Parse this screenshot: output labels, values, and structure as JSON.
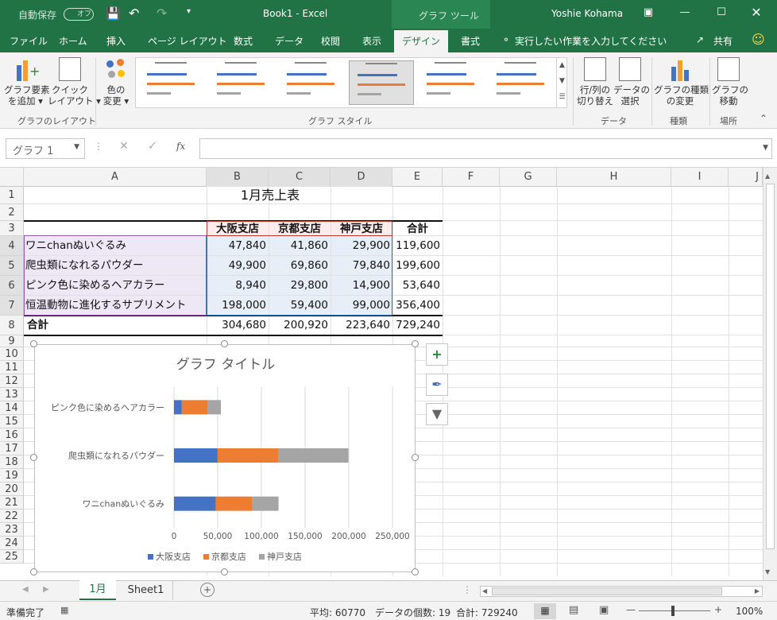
{
  "titlebar": {
    "autosave": "自動保存",
    "autosave_state": "オフ",
    "doc_title": "Book1 - Excel",
    "tools_context": "グラフ ツール",
    "user": "Yoshie Kohama"
  },
  "tabs": [
    "ファイル",
    "ホーム",
    "挿入",
    "ページ レイアウト",
    "数式",
    "データ",
    "校閲",
    "表示",
    "デザイン",
    "書式"
  ],
  "tell_me": "実行したい作業を入力してください",
  "share": "共有",
  "ribbon": {
    "add_element": [
      "グラフ要素",
      "を追加 ▾"
    ],
    "quick_layout": [
      "クイック",
      "レイアウト ▾"
    ],
    "change_colors": [
      "色の",
      "変更 ▾"
    ],
    "switch_rowcol": [
      "行/列の",
      "切り替え"
    ],
    "select_data": [
      "データの",
      "選択"
    ],
    "change_type": [
      "グラフの種類",
      "の変更"
    ],
    "move_chart": [
      "グラフの",
      "移動"
    ],
    "groups": {
      "layout": "グラフのレイアウト",
      "styles": "グラフ スタイル",
      "data": "データ",
      "type": "種類",
      "location": "場所"
    }
  },
  "formula": {
    "namebox": "グラフ 1",
    "fx": "fx"
  },
  "columns": [
    "A",
    "B",
    "C",
    "D",
    "E",
    "F",
    "G",
    "H",
    "I",
    "J"
  ],
  "rows": [
    "1",
    "2",
    "3",
    "4",
    "5",
    "6",
    "7",
    "8",
    "9",
    "10",
    "11",
    "12",
    "13",
    "14",
    "15",
    "16",
    "17",
    "18",
    "19",
    "20",
    "21",
    "22",
    "23",
    "24",
    "25"
  ],
  "sheet": {
    "title": "1月売上表",
    "headers": [
      "大阪支店",
      "京都支店",
      "神戸支店",
      "合計"
    ],
    "data": [
      {
        "name": "ワニchanぬいぐるみ",
        "vals": [
          "47,840",
          "41,860",
          "29,900",
          "119,600"
        ]
      },
      {
        "name": "爬虫類になれるパウダー",
        "vals": [
          "49,900",
          "69,860",
          "79,840",
          "199,600"
        ]
      },
      {
        "name": "ピンク色に染めるヘアカラー",
        "vals": [
          "8,940",
          "29,800",
          "14,900",
          "53,640"
        ]
      },
      {
        "name": "恒温動物に進化するサプリメント",
        "vals": [
          "198,000",
          "59,400",
          "99,000",
          "356,400"
        ]
      }
    ],
    "total": {
      "name": "合計",
      "vals": [
        "304,680",
        "200,920",
        "223,640",
        "729,240"
      ]
    }
  },
  "chart_data": {
    "type": "bar",
    "title": "グラフ タイトル",
    "categories": [
      "ワニchanぬいぐるみ",
      "爬虫類になれるパウダー",
      "ピンク色に染めるヘアカラー"
    ],
    "series": [
      {
        "name": "大阪支店",
        "values": [
          47840,
          49900,
          8940
        ],
        "color": "#4472c4"
      },
      {
        "name": "京都支店",
        "values": [
          41860,
          69860,
          29800
        ],
        "color": "#ed7d31"
      },
      {
        "name": "神戸支店",
        "values": [
          29900,
          79840,
          14900
        ],
        "color": "#a5a5a5"
      }
    ],
    "stacked": true,
    "xlim": [
      0,
      250000
    ],
    "xticks": [
      "0",
      "50,000",
      "100,000",
      "150,000",
      "200,000",
      "250,000"
    ],
    "legend": "bottom",
    "grid": true
  },
  "sheettabs": [
    "1月",
    "Sheet1"
  ],
  "status": {
    "ready": "準備完了",
    "average": "平均: 60770",
    "count": "データの個数: 19",
    "sum": "合計: 729240",
    "zoom": "100%"
  }
}
